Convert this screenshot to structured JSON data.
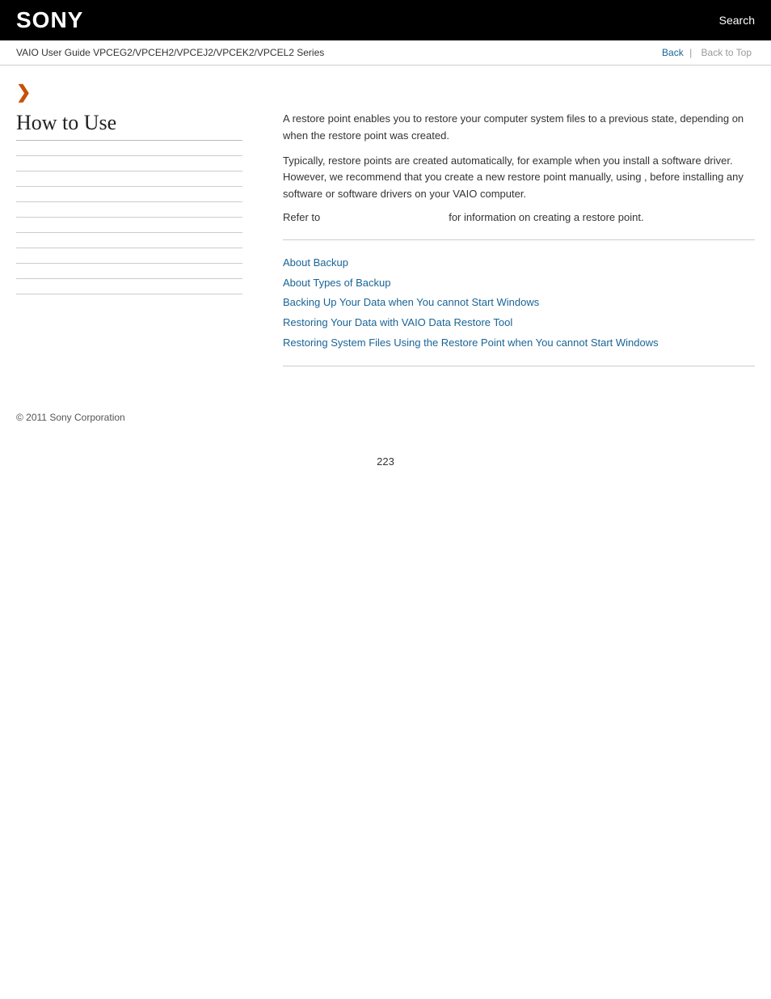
{
  "header": {
    "logo": "SONY",
    "search_label": "Search"
  },
  "breadcrumb": {
    "text": "VAIO User Guide VPCEG2/VPCEH2/VPCEJ2/VPCEK2/VPCEL2 Series",
    "back_label": "Back",
    "back_to_top_label": "Back to Top"
  },
  "sidebar": {
    "title": "How to Use",
    "dividers": 10
  },
  "content": {
    "paragraph1": "A restore point enables you to restore your computer system files to a previous state, depending on when the restore point was created.",
    "paragraph2": "Typically, restore points are created automatically, for example when you install a software driver. However, we recommend that you create a new restore point manually, using                        , before installing any software or software drivers on your VAIO computer.",
    "refer_prefix": "Refer to",
    "refer_suffix": "for information on creating a restore point.",
    "links": [
      {
        "label": "About Backup",
        "href": "#"
      },
      {
        "label": "About Types of Backup",
        "href": "#"
      },
      {
        "label": "Backing Up Your Data when You cannot Start Windows",
        "href": "#"
      },
      {
        "label": "Restoring Your Data with VAIO Data Restore Tool",
        "href": "#"
      },
      {
        "label": "Restoring System Files Using the Restore Point when You cannot Start Windows",
        "href": "#"
      }
    ]
  },
  "footer": {
    "copyright": "© 2011 Sony Corporation"
  },
  "page_number": "223"
}
